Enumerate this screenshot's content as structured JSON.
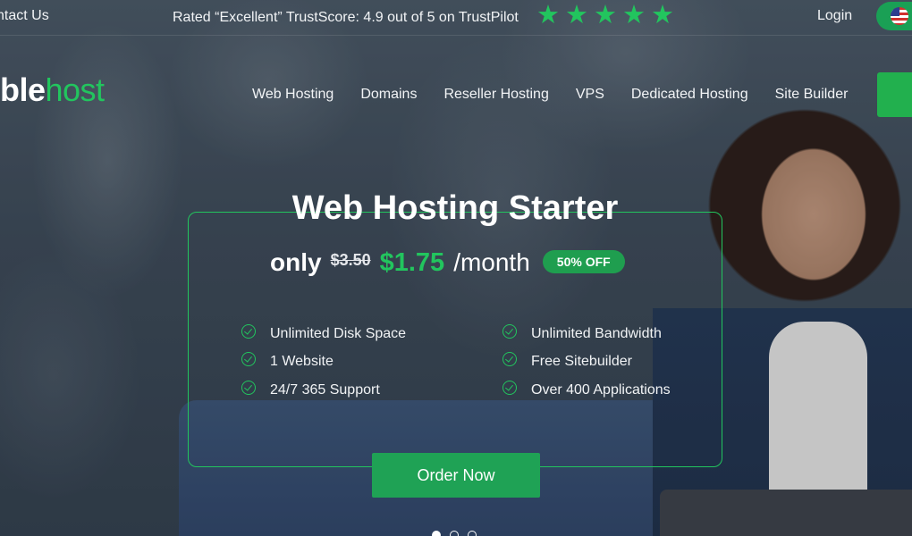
{
  "topbar": {
    "contact": "ntact Us",
    "rating": "Rated “Excellent” TrustScore: 4.9 out of 5 on TrustPilot",
    "stars": [
      "★",
      "★",
      "★",
      "★",
      "★"
    ],
    "login": "Login"
  },
  "logo": {
    "part1": "ble",
    "part2": "host"
  },
  "nav": {
    "items": [
      "Web Hosting",
      "Domains",
      "Reseller Hosting",
      "VPS",
      "Dedicated Hosting",
      "Site Builder"
    ]
  },
  "hero": {
    "title": "Web Hosting Starter",
    "only": "only",
    "old_price": "$3.50",
    "new_price": "$1.75",
    "per": "/month",
    "badge": "50% OFF",
    "features_left": [
      "Unlimited Disk Space",
      "1 Website",
      "24/7 365 Support"
    ],
    "features_right": [
      "Unlimited Bandwidth",
      "Free Sitebuilder",
      "Over 400 Applications"
    ],
    "order_button": "Order Now"
  },
  "colors": {
    "accent": "#22c55e",
    "button": "#1fa255"
  },
  "carousel": {
    "active_index": 0,
    "count": 3
  }
}
